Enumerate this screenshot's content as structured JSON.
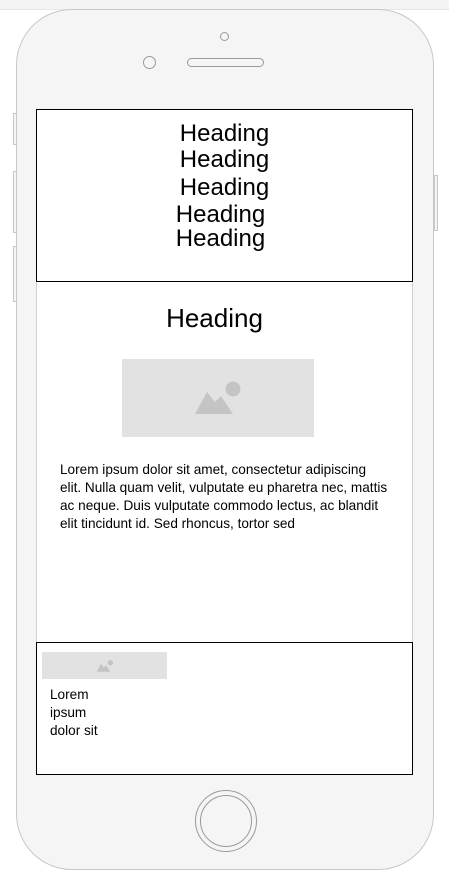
{
  "header": {
    "headings": [
      "Heading",
      "Heading",
      "Heading",
      "Heading",
      "Heading"
    ]
  },
  "content": {
    "heading": "Heading",
    "image_icon": "image-placeholder-icon",
    "paragraph": "Lorem ipsum dolor sit amet, consectetur adipiscing elit. Nulla quam velit, vulputate eu pharetra nec, mattis ac neque. Duis vulputate commodo lectus, ac blandit elit tincidunt id. Sed rhoncus, tortor sed"
  },
  "footer": {
    "image_icon": "image-placeholder-icon",
    "text": "Lorem ipsum dolor sit"
  },
  "colors": {
    "device_body": "#f5f5f5",
    "device_outline": "#c8c8c8",
    "placeholder": "#e2e2e2",
    "placeholder_icon": "#c4c4c4",
    "frame_border": "#000000"
  }
}
